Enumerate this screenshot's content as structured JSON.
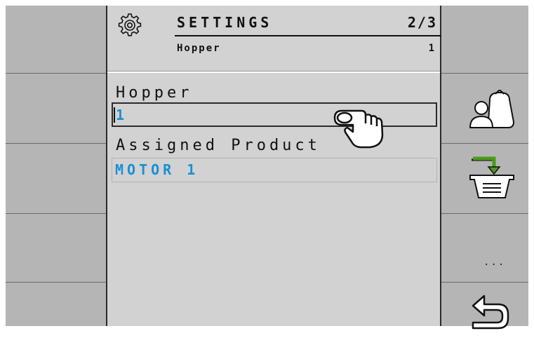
{
  "header": {
    "title": "SETTINGS",
    "page_indicator": "2/3",
    "subtitle": "Hopper",
    "subtitle_value": "1",
    "icon": "gear-icon"
  },
  "form": {
    "hopper_label": "Hopper",
    "hopper_value": "1",
    "assigned_product_label": "Assigned Product",
    "assigned_product_value": "MOTOR 1"
  },
  "softkeys": {
    "right": [
      {
        "icon": "operator-product-icon"
      },
      {
        "icon": "hopper-assign-icon"
      },
      {
        "label": "...",
        "icon": "more-icon"
      },
      {
        "icon": "back-icon"
      }
    ]
  },
  "colors": {
    "value_text": "#1a8fd4",
    "screen_bg": "#d2d2d2",
    "softkey_bg": "#b5b5b5",
    "arrow_green": "#4a9a1a"
  }
}
